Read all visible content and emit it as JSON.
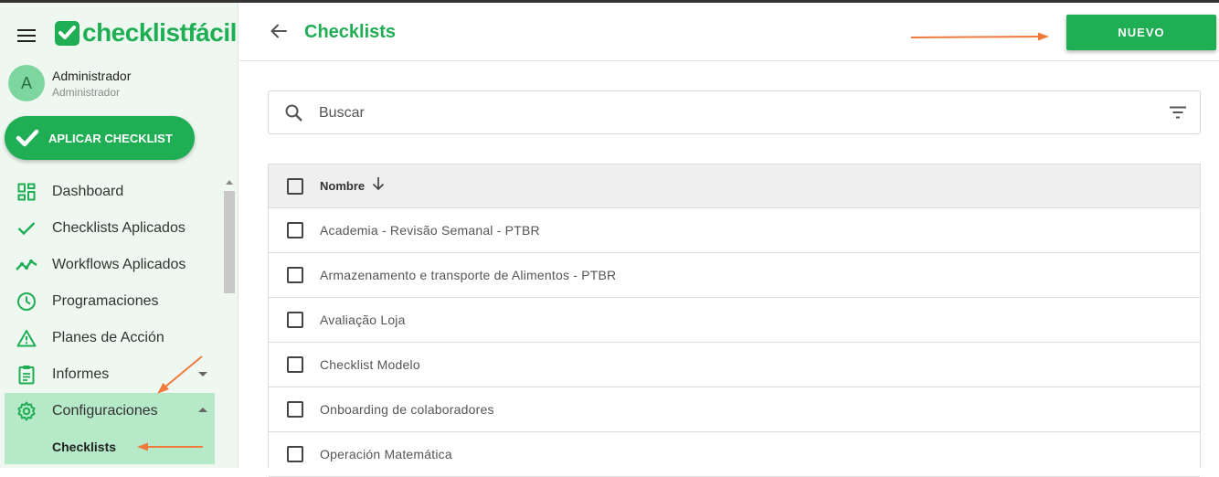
{
  "brand": {
    "name": "checklistfácil",
    "color": "#1fae54"
  },
  "user": {
    "initial": "A",
    "name": "Administrador",
    "role": "Administrador"
  },
  "sidebar": {
    "apply_button": "APLICAR CHECKLIST",
    "items": [
      {
        "label": "Dashboard",
        "icon": "dashboard-icon"
      },
      {
        "label": "Checklists Aplicados",
        "icon": "check-icon"
      },
      {
        "label": "Workflows Aplicados",
        "icon": "trending-icon"
      },
      {
        "label": "Programaciones",
        "icon": "clock-icon"
      },
      {
        "label": "Planes de Acción",
        "icon": "warning-icon"
      },
      {
        "label": "Informes",
        "icon": "clipboard-icon"
      },
      {
        "label": "Configuraciones",
        "icon": "gear-icon"
      }
    ],
    "sub_item": "Checklists"
  },
  "header": {
    "title": "Checklists",
    "new_button": "NUEVO"
  },
  "search": {
    "placeholder": "Buscar"
  },
  "table": {
    "column": "Nombre",
    "rows": [
      "Academia - Revisão Semanal - PTBR",
      "Armazenamento e transporte de Alimentos - PTBR",
      "Avaliação Loja",
      "Checklist Modelo",
      "Onboarding de colaboradores",
      "Operación Matemática"
    ]
  },
  "annotation_color": "#f07a3c"
}
